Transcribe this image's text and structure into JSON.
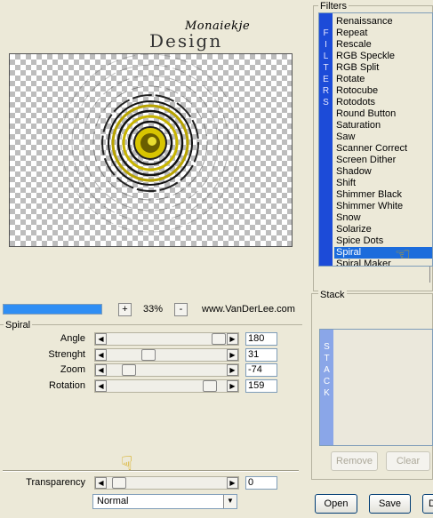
{
  "watermark": {
    "top": "Monaiekje",
    "bottom": "Design"
  },
  "zoom": {
    "plus": "+",
    "value": "33%",
    "minus": "-"
  },
  "website": "www.VanDerLee.com",
  "progress": 1.0,
  "spiral_group": {
    "title": "Spiral"
  },
  "params": [
    {
      "label": "Angle",
      "value": "180",
      "level": 0.97
    },
    {
      "label": "Strenght",
      "value": "31",
      "level": 0.31
    },
    {
      "label": "Zoom",
      "value": "-74",
      "level": 0.13
    },
    {
      "label": "Rotation",
      "value": "159",
      "level": 0.95
    }
  ],
  "transparency": {
    "label": "Transparency",
    "value": "0",
    "level": 0.05
  },
  "blend_mode": {
    "selected": "Normal"
  },
  "filters": {
    "title": "Filters",
    "strip_letters": [
      "F",
      "I",
      "L",
      "T",
      "E",
      "R",
      "S"
    ],
    "items": [
      "Renaissance",
      "Repeat",
      "Rescale",
      "RGB Speckle",
      "RGB Split",
      "Rotate",
      "Rotocube",
      "Rotodots",
      "Round Button",
      "Saturation",
      "Saw",
      "Scanner Correct",
      "Screen Dither",
      "Shadow",
      "Shift",
      "Shimmer Black",
      "Shimmer White",
      "Snow",
      "Solarize",
      "Spice Dots",
      "Spiral",
      "Spiral Maker"
    ],
    "selected_index": 20
  },
  "stack": {
    "title": "Stack",
    "strip_letters": [
      "S",
      "T",
      "A",
      "C",
      "K"
    ],
    "remove_label": "Remove",
    "clear_label": "Clear"
  },
  "buttons": {
    "open": "Open",
    "save": "Save",
    "third": "D"
  },
  "colors": {
    "accent": "#1c4bd8",
    "selection": "#1c6cdc",
    "spiral_gold": "#c8b400"
  }
}
